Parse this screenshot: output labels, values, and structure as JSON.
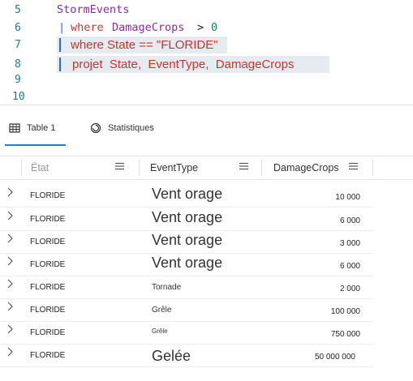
{
  "editor": {
    "lines": [
      {
        "number": "5",
        "tokens": [
          "StormEvents"
        ]
      },
      {
        "number": "6",
        "tokens": [
          "|",
          "where",
          "DamageCrops",
          ">",
          "0"
        ]
      },
      {
        "number": "7",
        "text": "where State == \"FLORIDE\""
      },
      {
        "number": "8",
        "text": "projet  State,  EventType,  DamageCrops"
      },
      {
        "number": "9"
      },
      {
        "number": "10"
      }
    ]
  },
  "tabs": [
    {
      "label": "Table 1",
      "icon": "table-icon",
      "active": true
    },
    {
      "label": "Statistiques",
      "icon": "stats-icon",
      "active": false
    }
  ],
  "grid": {
    "columns": [
      "État",
      "EventType",
      "DamageCrops"
    ],
    "rows": [
      {
        "state": "FLORIDE",
        "event": "Vent orage",
        "damage": "10 000"
      },
      {
        "state": "FLORIDE",
        "event": "Vent orage",
        "damage": "6 000"
      },
      {
        "state": "FLORIDE",
        "event": "Vent orage",
        "damage": "3 000"
      },
      {
        "state": "FLORIDE",
        "event": "Vent orage",
        "damage": "6 000"
      },
      {
        "state": "FLORIDE",
        "event": "Tornade",
        "damage": "2 000"
      },
      {
        "state": "FLORIDE",
        "event": "Grêle",
        "damage": "100 000"
      },
      {
        "state": "FLORIDE",
        "event": "Grêle",
        "damage": "750 000"
      },
      {
        "state": "FLORIDE",
        "event": "Gelée",
        "damage": "50 000 000"
      }
    ]
  },
  "colors": {
    "accent": "#2b79d0",
    "keyword": "#c0392b",
    "identifier": "#8a2aa8",
    "line_number": "#237893"
  }
}
